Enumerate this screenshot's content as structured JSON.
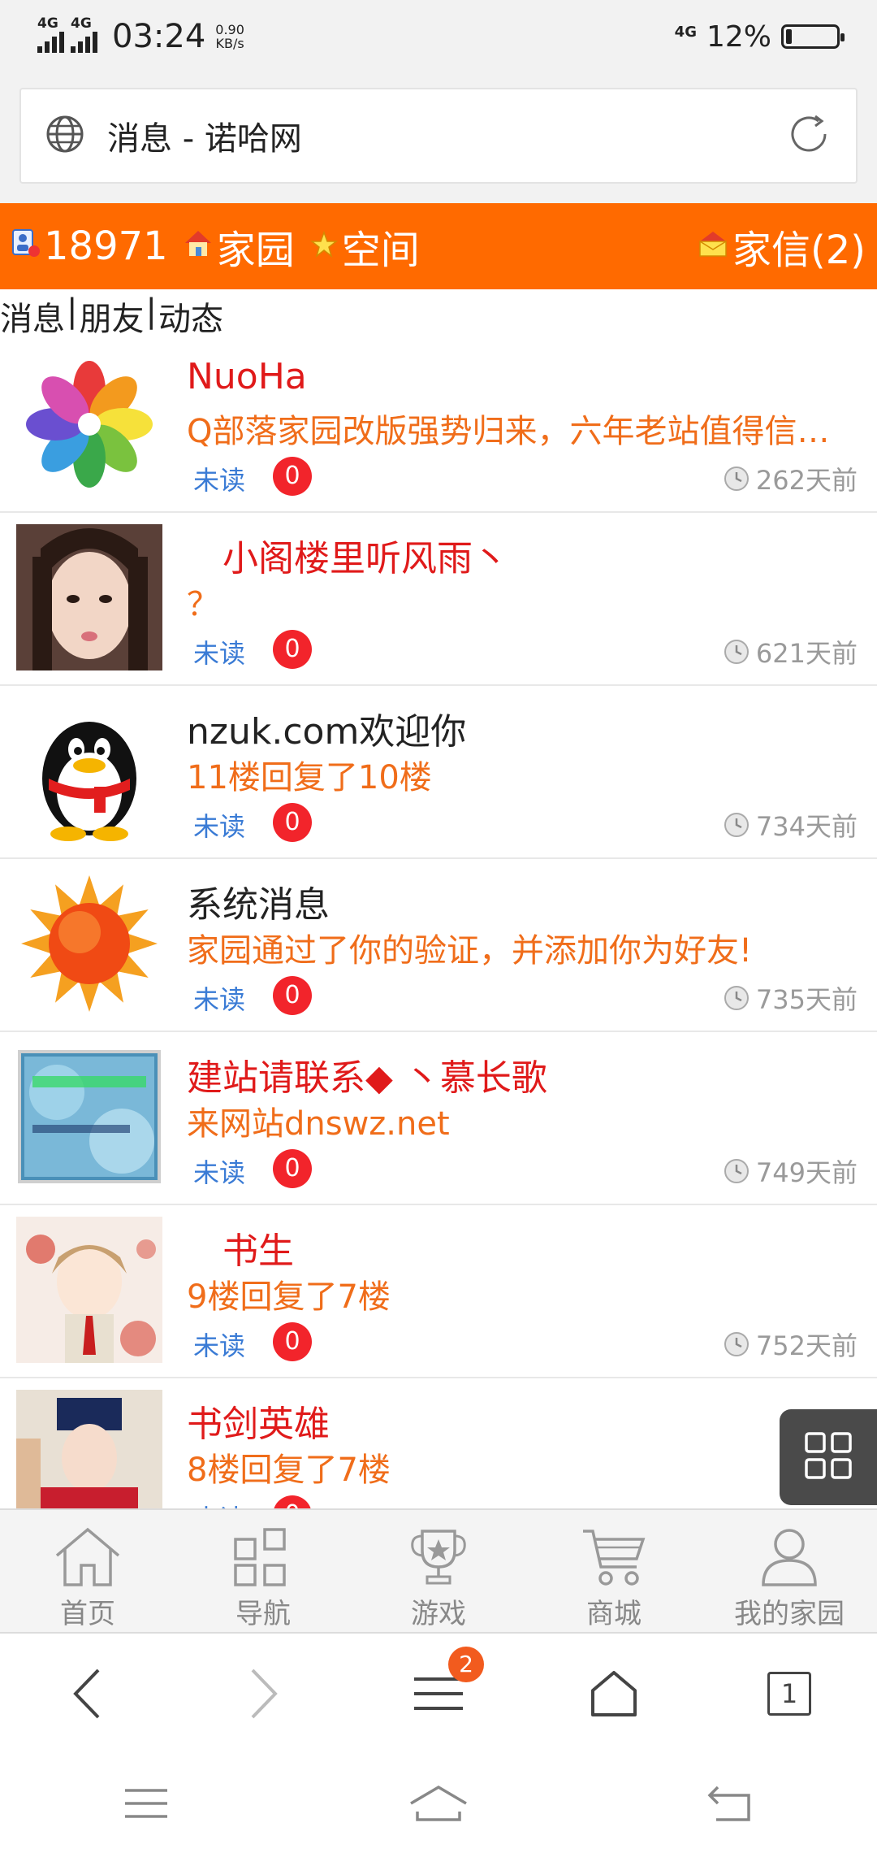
{
  "status_bar": {
    "net1": "4G",
    "net2": "4G",
    "time": "03:24",
    "speed_value": "0.90",
    "speed_unit": "KB/s",
    "net3": "4G",
    "battery": "12%",
    "battery_level": 0.12
  },
  "address_bar": {
    "title": "消息 - 诺哈网"
  },
  "header": {
    "user_id": "18971",
    "home": "家园",
    "space": "空间",
    "mail": "家信(2)"
  },
  "tabs": {
    "messages": "消息",
    "friends": "朋友",
    "activity": "动态",
    "sep": "|"
  },
  "messages": [
    {
      "name": "NuoHa",
      "name_color": "red",
      "text": "Q部落家园改版强势归来，六年老站值得信赖！",
      "status": "未读",
      "count": "0",
      "time": "262天前",
      "avatar": "flower"
    },
    {
      "name": "　小阁楼里听风雨丶",
      "name_color": "red",
      "text": "？",
      "status": "未读",
      "count": "0",
      "time": "621天前",
      "avatar": "girl-photo"
    },
    {
      "name": "nzuk.com欢迎你",
      "name_color": "dark",
      "text": "11楼回复了10楼",
      "status": "未读",
      "count": "0",
      "time": "734天前",
      "avatar": "penguin"
    },
    {
      "name": "系统消息",
      "name_color": "dark",
      "text": "家园通过了你的验证，并添加你为好友!",
      "status": "未读",
      "count": "0",
      "time": "735天前",
      "avatar": "sun"
    },
    {
      "name": "建站请联系◆ 丶慕长歌",
      "name_color": "red",
      "text": "来网站dnswz.net",
      "status": "未读",
      "count": "0",
      "time": "749天前",
      "avatar": "banner"
    },
    {
      "name": "　书生",
      "name_color": "red",
      "text": "9楼回复了7楼",
      "status": "未读",
      "count": "0",
      "time": "752天前",
      "avatar": "anime-boy"
    },
    {
      "name": "书剑英雄",
      "name_color": "red",
      "text": "8楼回复了7楼",
      "status": "未读",
      "count": "0",
      "time": "",
      "avatar": "costume-boy"
    }
  ],
  "site_nav": {
    "home": "首页",
    "navigation": "导航",
    "games": "游戏",
    "shop": "商城",
    "my_home": "我的家园"
  },
  "browser_bar": {
    "menu_badge": "2",
    "tab_count": "1"
  },
  "colors": {
    "accent": "#ff6a00",
    "name_red": "#e01a1a",
    "text_orange": "#f06d1a",
    "status_blue": "#3a7bd5",
    "badge_red": "#f2242b"
  }
}
